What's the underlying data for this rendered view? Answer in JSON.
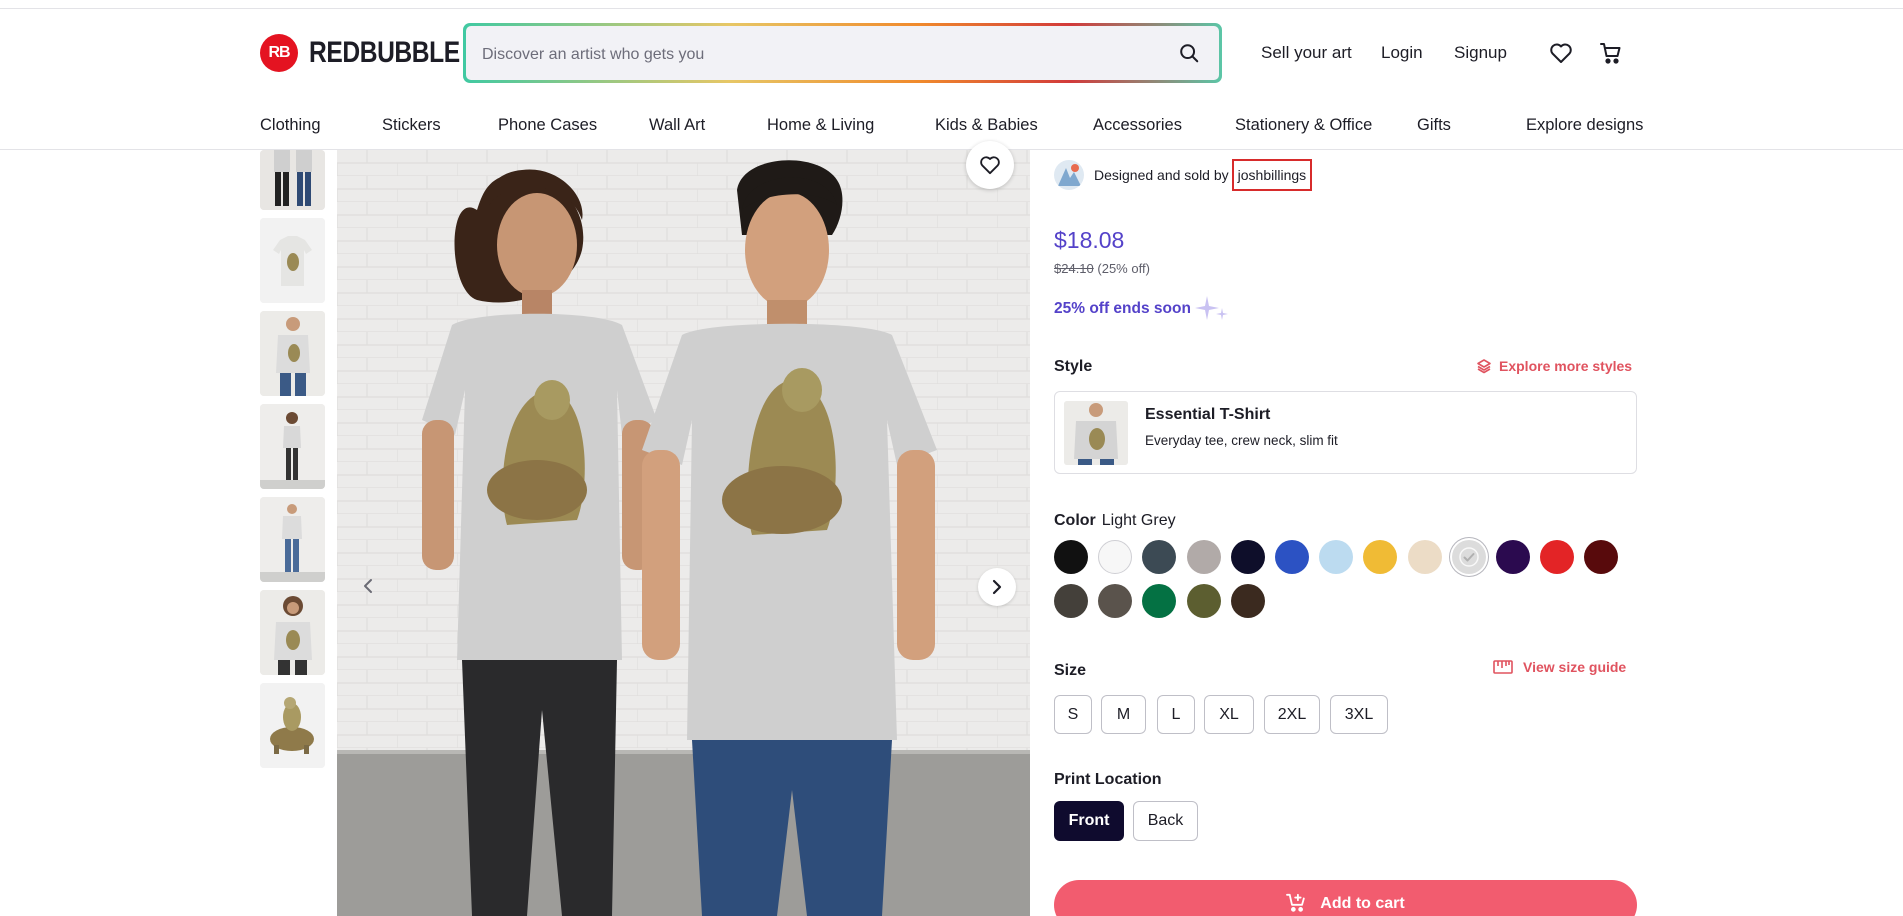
{
  "brand": {
    "name": "REDBUBBLE",
    "mark": "RB"
  },
  "search": {
    "placeholder": "Discover an artist who gets you",
    "value": ""
  },
  "header": {
    "sell_label": "Sell your art",
    "login_label": "Login",
    "signup_label": "Signup"
  },
  "categories": [
    "Clothing",
    "Stickers",
    "Phone Cases",
    "Wall Art",
    "Home & Living",
    "Kids & Babies",
    "Accessories",
    "Stationery & Office",
    "Gifts",
    "Explore designs"
  ],
  "product": {
    "designed_by": "Designed and sold by",
    "artist": "joshbillings",
    "price": "$18.08",
    "original_price": "$24.10",
    "discount": "(25% off)",
    "promo": "25% off ends soon"
  },
  "style": {
    "label": "Style",
    "explore_label": "Explore more styles",
    "name": "Essential T-Shirt",
    "description": "Everyday tee, crew neck, slim fit"
  },
  "color": {
    "label": "Color",
    "selected": "Light Grey",
    "swatches": [
      "#111111",
      "#f7f7f7",
      "#3c4a54",
      "#b1aaa8",
      "#0e0e2a",
      "#2c52c3",
      "#bcdbf0",
      "#f0bb35",
      "#ecdcc6",
      "#dcdcdc",
      "#2b0a4f",
      "#e32426",
      "#580a0c",
      "#44403a",
      "#5a534c",
      "#047143",
      "#5c5e30",
      "#3b2a1f"
    ]
  },
  "size": {
    "label": "Size",
    "guide_label": "View size guide",
    "options": [
      "S",
      "M",
      "L",
      "XL",
      "2XL",
      "3XL"
    ]
  },
  "print_location": {
    "label": "Print Location",
    "options": [
      "Front",
      "Back"
    ],
    "selected": "Front"
  },
  "cart": {
    "label": "Add to cart"
  },
  "colors": {
    "accent": "#5442c9",
    "brand": "#e41321",
    "cta": "#f25c6f",
    "link": "#e0535f"
  }
}
